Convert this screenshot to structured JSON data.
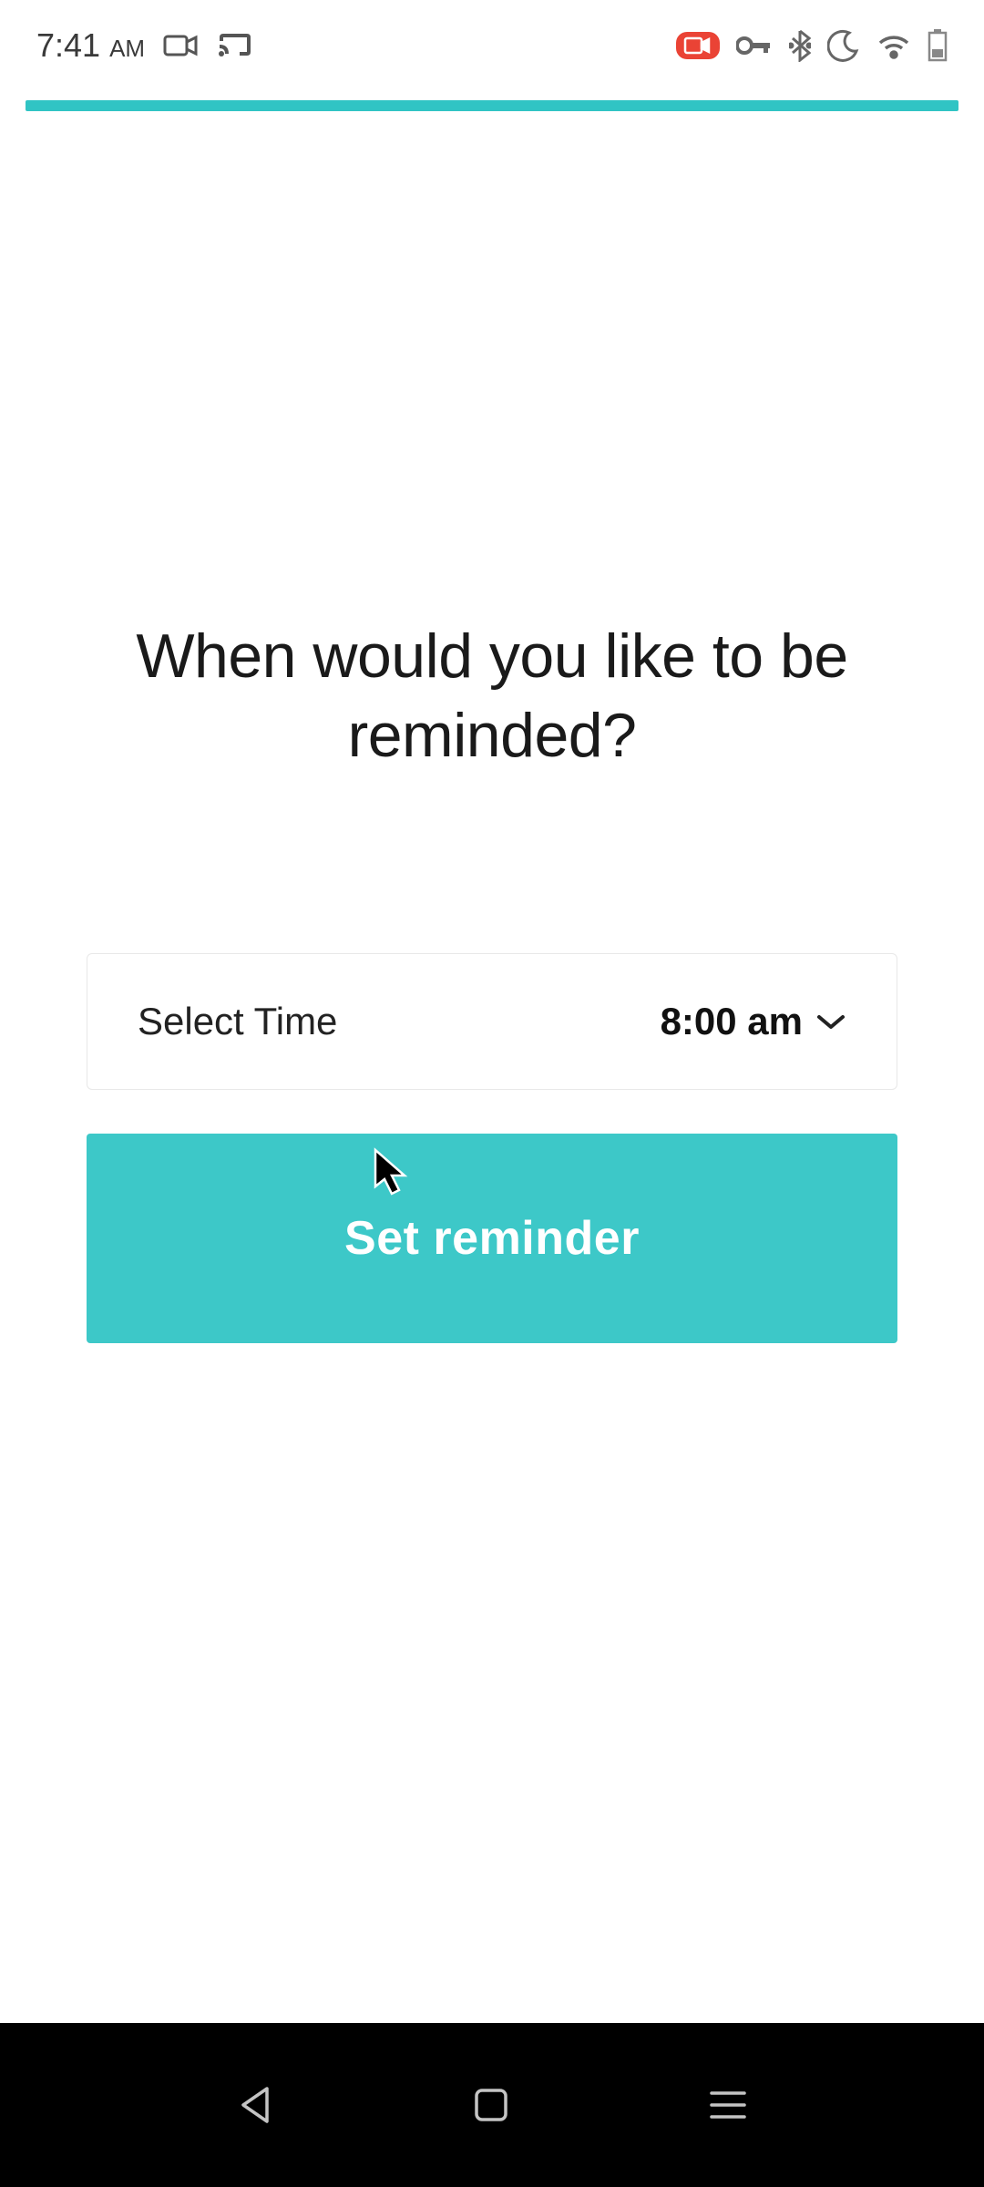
{
  "status": {
    "time": "7:41",
    "ampm": "AM"
  },
  "progress": {
    "percent": 100
  },
  "main": {
    "heading": "When would you like to be reminded?",
    "time_label": "Select Time",
    "time_value": "8:00 am",
    "button_label": "Set reminder"
  },
  "colors": {
    "accent": "#3dc8c8",
    "button_text": "#ffffff"
  }
}
